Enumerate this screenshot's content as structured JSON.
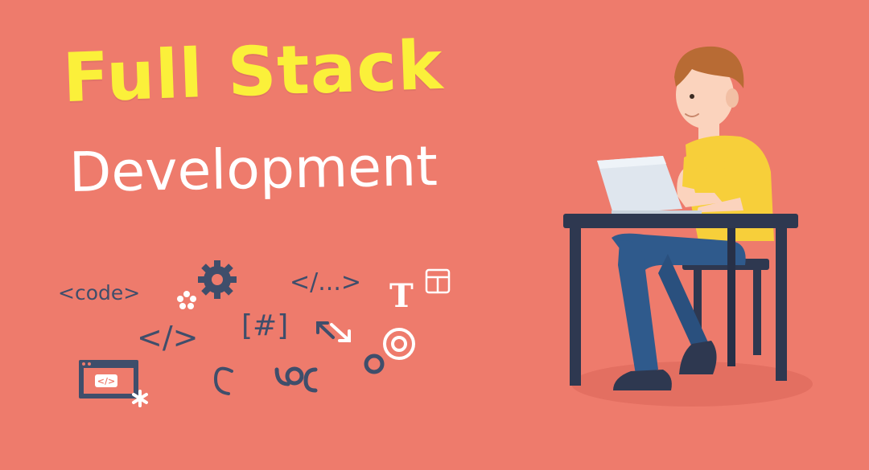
{
  "banner": {
    "title_line_1": "Full Stack",
    "title_line_2": "Development"
  },
  "code_snippets": {
    "code_tag": "<code>",
    "ellipsis_tag": "</...>",
    "close_tag": "</>",
    "hash_bracket": "[#]",
    "t_letter": "T",
    "window_code": "</>"
  },
  "icons": [
    "gear-icon",
    "flower-icon",
    "asterisk-icon",
    "browser-window-icon",
    "layout-icon",
    "arrows-icon",
    "target-icon",
    "circle-icon",
    "hook-icon",
    "chain-icon"
  ],
  "colors": {
    "background": "#ee7b6c",
    "title_yellow": "#fbf03a",
    "subtitle_white": "#ffffff",
    "icon_navy": "#3f4e6b",
    "shirt_yellow": "#f7cf3a",
    "pants_blue": "#2f5a8c",
    "desk_navy": "#2e3850",
    "laptop_grey": "#dfe6ee"
  }
}
